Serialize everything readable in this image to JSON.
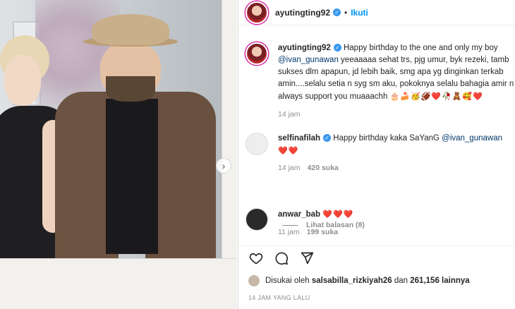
{
  "post": {
    "author": "ayutingting92",
    "follow_label": "Ikuti",
    "separator": "•"
  },
  "caption": {
    "username": "ayutingting92",
    "text_pre": "Happy birthday to the one and only my boy ",
    "mention": "@ivan_gunawan",
    "text_post": " yeeaaaaa sehat trs, pjg umur, byk rezeki, tamb sukses dlm apapun, jd lebih baik, smg apa yg dinginkan terkab amin....selalu setia n syg sm aku, pokoknya selalu bahagia amir n always support you muaaachh ",
    "emojis": "🎂🍰🥳🏈❤️🥀🧸🥰❤️",
    "time": "14 jam"
  },
  "comments": [
    {
      "username": "selfinafilah",
      "text_pre": "Happy birthday kaka SaYanG ",
      "mention": "@ivan_gunawan",
      "emojis": "❤️❤️",
      "time": "14 jam",
      "likes": "420 suka",
      "replies": "Lihat balasan (8)"
    },
    {
      "username": "anwar_bab",
      "emojis": "❤️❤️❤️",
      "time": "11 jam",
      "likes": "199 suka"
    }
  ],
  "liked_by": {
    "prefix": "Disukai oleh",
    "user": "salsabilla_rizkiyah26",
    "conj": "dan",
    "others": "261,156 lainnya"
  },
  "posted_time": "14 JAM YANG LALU",
  "icons": [
    "heart-icon",
    "comment-icon",
    "share-icon",
    "next-arrow-icon",
    "verified-icon"
  ]
}
